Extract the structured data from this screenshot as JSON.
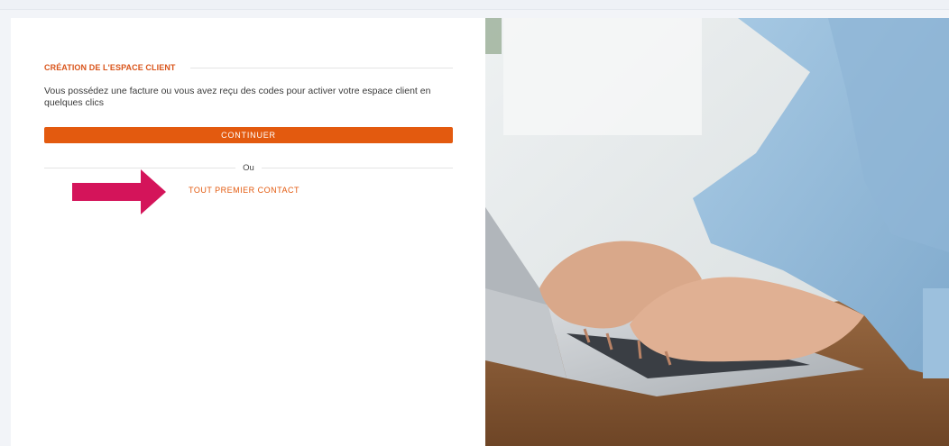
{
  "form": {
    "section_title": "CRÉATION DE L'ESPACE CLIENT",
    "description": "Vous possédez une facture ou vous avez reçu des codes pour activer votre espace client en quelques clics",
    "continue_label": "CONTINUER",
    "or_label": "Ou",
    "first_contact_label": "TOUT PREMIER CONTACT"
  },
  "colors": {
    "accent": "#e35a0f",
    "arrow": "#d4145a",
    "title": "#d9541a"
  },
  "icons": {
    "annotation_arrow": "right-arrow-icon"
  }
}
